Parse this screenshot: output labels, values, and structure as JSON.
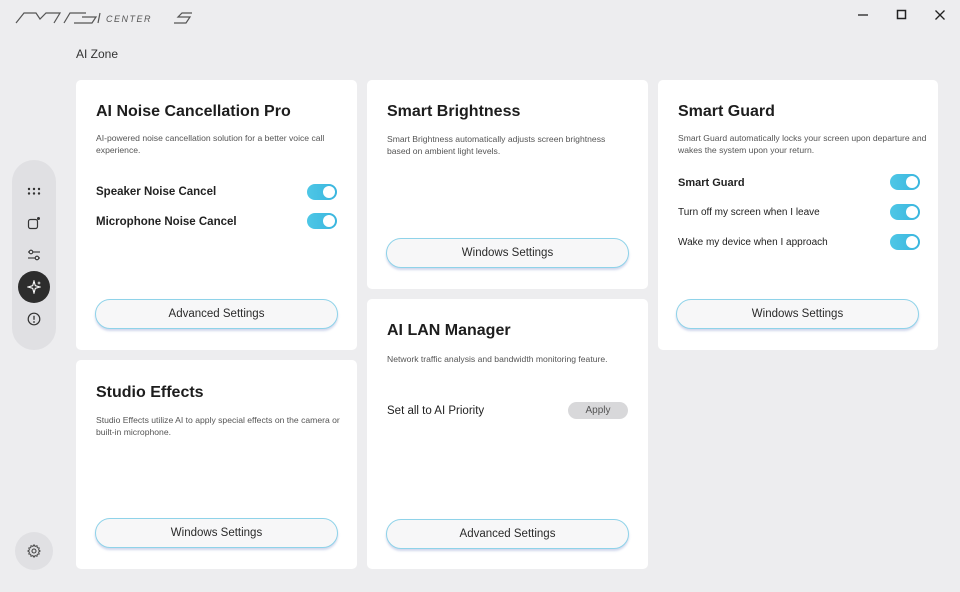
{
  "app": {
    "logo_text": "MSI CENTER S",
    "page_title": "AI Zone"
  },
  "window_controls": [
    "minimize",
    "maximize",
    "close"
  ],
  "sidenav": {
    "items": [
      {
        "icon": "grid-dots-icon",
        "active": false
      },
      {
        "icon": "device-icon",
        "active": false
      },
      {
        "icon": "sliders-icon",
        "active": false
      },
      {
        "icon": "sparkle-icon",
        "active": true
      },
      {
        "icon": "info-icon",
        "active": false
      }
    ],
    "settings_icon": "gear-icon"
  },
  "cards": {
    "noise": {
      "title": "AI Noise Cancellation Pro",
      "desc": "AI-powered noise cancellation solution for a better voice call experience.",
      "speaker_label": "Speaker Noise Cancel",
      "speaker_on": true,
      "mic_label": "Microphone Noise Cancel",
      "mic_on": true,
      "button": "Advanced Settings"
    },
    "brightness": {
      "title": "Smart Brightness",
      "desc": "Smart Brightness automatically adjusts screen brightness based on ambient light levels.",
      "button": "Windows Settings"
    },
    "guard": {
      "title": "Smart Guard",
      "desc": "Smart Guard automatically locks your screen upon departure and wakes the system upon your return.",
      "main_label": "Smart Guard",
      "turn_off_label": "Turn off my screen when I leave",
      "wake_label": "Wake my device when I approach",
      "button": "Windows Settings"
    },
    "studio": {
      "title": "Studio Effects",
      "desc": "Studio Effects utilize AI to apply special effects on the camera or built-in microphone.",
      "button": "Windows Settings"
    },
    "lan": {
      "title": "AI LAN Manager",
      "desc": "Network traffic analysis and bandwidth monitoring feature.",
      "priority_label": "Set all to AI Priority",
      "apply": "Apply",
      "button": "Advanced Settings"
    }
  },
  "colors": {
    "background": "#ededef",
    "card": "#ffffff",
    "toggle_on": "#3fbde2",
    "button_border": "#8fd3e9",
    "active_nav": "#2d2d2d"
  }
}
